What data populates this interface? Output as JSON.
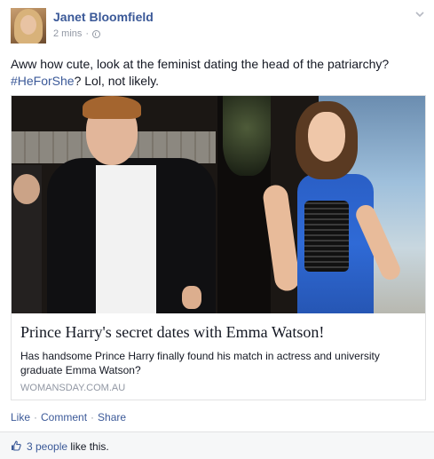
{
  "author": {
    "name": "Janet Bloomfield",
    "timestamp": "2 mins",
    "separator": "·"
  },
  "status": {
    "text_before": "Aww how cute, look at the feminist dating the head of the patriarchy? ",
    "hashtag": "#HeForShe",
    "text_after": "? Lol, not likely."
  },
  "link_card": {
    "title": "Prince Harry's secret dates with Emma Watson!",
    "description": "Has handsome Prince Harry finally found his match in actress and university graduate Emma Watson?",
    "domain": "WOMANSDAY.COM.AU"
  },
  "actions": {
    "like": "Like",
    "comment": "Comment",
    "share": "Share",
    "separator": "·"
  },
  "likes": {
    "people": "3 people",
    "suffix": " like this."
  },
  "colors": {
    "link_blue": "#3b5998",
    "meta_gray": "#9197a3",
    "text": "#141823",
    "like_bar_bg": "#f6f7f8"
  },
  "icons": [
    "globe-icon",
    "chevron-down-icon",
    "thumbs-up-icon"
  ]
}
